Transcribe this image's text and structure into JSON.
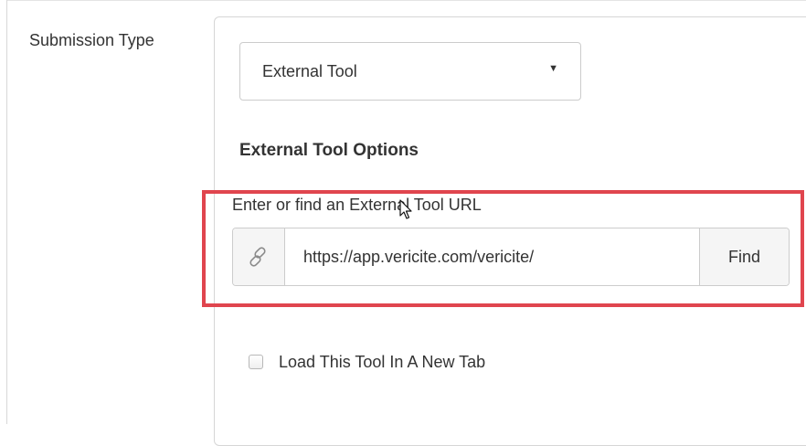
{
  "form": {
    "submission_type_label": "Submission Type",
    "select": {
      "selected_value": "External Tool",
      "caret": "▼"
    },
    "external_tool_options": {
      "heading": "External Tool Options",
      "url_label": "Enter or find an External Tool URL",
      "url_value": "https://app.vericite.com/vericite/",
      "link_icon": "link-icon",
      "find_label": "Find"
    },
    "new_tab_checkbox": {
      "label": "Load This Tool In A New Tab",
      "checked": false
    }
  },
  "colors": {
    "highlight": "#e0454e",
    "border": "#cccccc",
    "addon_bg": "#f5f5f5",
    "text": "#333333"
  }
}
